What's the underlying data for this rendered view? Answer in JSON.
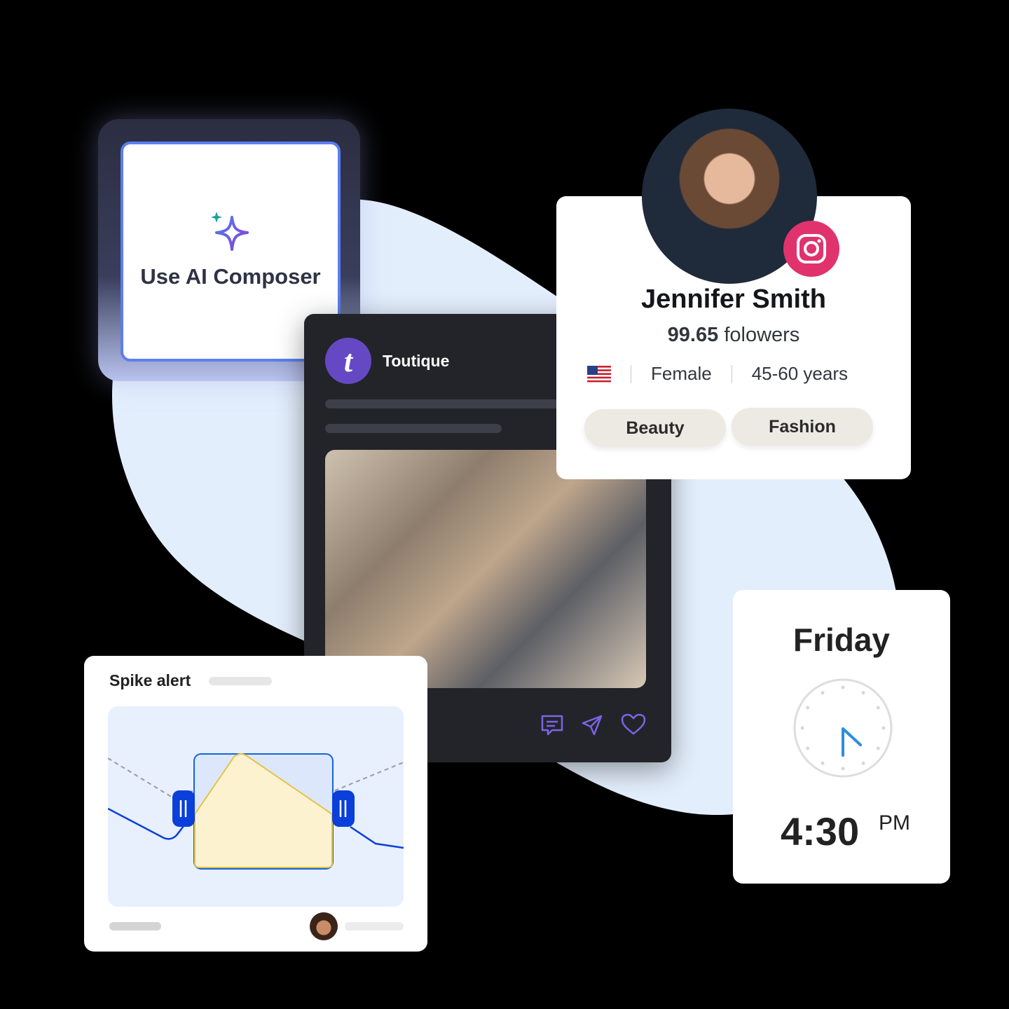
{
  "ai_composer": {
    "label": "Use AI Composer",
    "icon": "sparkle-icon"
  },
  "post": {
    "brand": "Toutique",
    "logo_letter": "t",
    "actions": [
      "comment-icon",
      "send-icon",
      "heart-icon"
    ]
  },
  "profile": {
    "name": "Jennifer Smith",
    "followers_count": "99.65",
    "followers_label": "folowers",
    "country": "United States",
    "gender": "Female",
    "age": "45-60 years",
    "tags": [
      "Beauty",
      "Fashion"
    ],
    "network": "instagram-icon"
  },
  "spike_alert": {
    "title": "Spike alert"
  },
  "schedule": {
    "day": "Friday",
    "time": "4:30",
    "ampm": "PM"
  },
  "colors": {
    "accent": "#5b7ef0",
    "brand": "#6549c4",
    "instagram": "#e0336d",
    "handle": "#0a3fd9",
    "highlight": "#fdf2cf"
  }
}
